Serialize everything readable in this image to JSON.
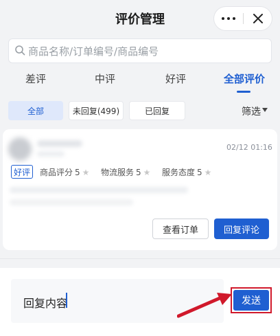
{
  "header": {
    "title": "评价管理"
  },
  "search": {
    "placeholder": "商品名称/订单编号/商品编号"
  },
  "tabs": [
    {
      "label": "差评"
    },
    {
      "label": "中评"
    },
    {
      "label": "好评"
    },
    {
      "label": "全部评价",
      "active": true
    }
  ],
  "filters": {
    "chips": [
      {
        "label": "全部",
        "selected": true
      },
      {
        "label": "未回复(499)"
      },
      {
        "label": "已回复"
      }
    ],
    "filter_label": "筛选"
  },
  "review": {
    "date": "02/12 01:16",
    "tag": "好评",
    "ratings": [
      {
        "label": "商品评分",
        "score": "5"
      },
      {
        "label": "物流服务",
        "score": "5"
      },
      {
        "label": "服务态度",
        "score": "5"
      }
    ],
    "view_order_label": "查看订单",
    "reply_label": "回复评论"
  },
  "reply_panel": {
    "input_value": "回复内容",
    "send_label": "发送"
  },
  "colors": {
    "accent": "#1f5fd1",
    "highlight_border": "#d0192b"
  }
}
